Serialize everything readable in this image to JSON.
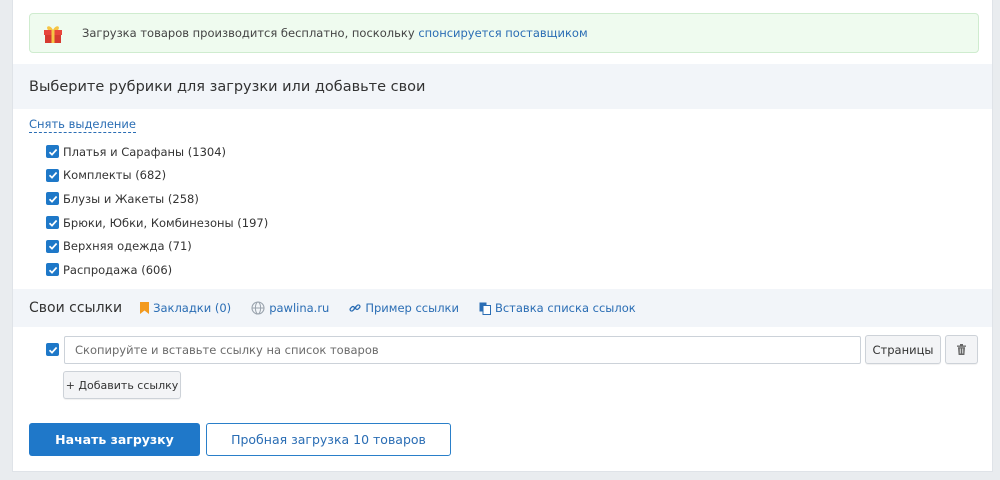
{
  "notice": {
    "text": "Загрузка товаров производится бесплатно, поскольку ",
    "link": "спонсируется поставщиком",
    "icon": "gift-icon"
  },
  "categories": {
    "title": "Выберите рубрики для загрузки или добавьте свои",
    "deselect": "Снять выделение",
    "items": [
      {
        "label": "Платья и Сарафаны (1304)",
        "checked": true
      },
      {
        "label": "Комплекты (682)",
        "checked": true
      },
      {
        "label": "Блузы и Жакеты (258)",
        "checked": true
      },
      {
        "label": "Брюки, Юбки, Комбинезоны (197)",
        "checked": true
      },
      {
        "label": "Верхняя одежда (71)",
        "checked": true
      },
      {
        "label": "Распродажа (606)",
        "checked": true
      }
    ]
  },
  "links": {
    "title": "Свои ссылки",
    "bookmarks": "Закладки (0)",
    "domain": "pawlina.ru",
    "example": "Пример ссылки",
    "paste_list": "Вставка списка ссылок"
  },
  "url_row": {
    "checked": true,
    "placeholder": "Скопируйте и вставьте ссылку на список товаров",
    "pages_button": "Страницы",
    "add_button": "+ Добавить ссылку"
  },
  "actions": {
    "start": "Начать загрузку",
    "trial": "Пробная загрузка 10 товаров"
  },
  "colors": {
    "accent": "#1f78c9",
    "link": "#2a6db4",
    "notice_bg": "#effbef",
    "bookmark": "#f39a1e"
  }
}
